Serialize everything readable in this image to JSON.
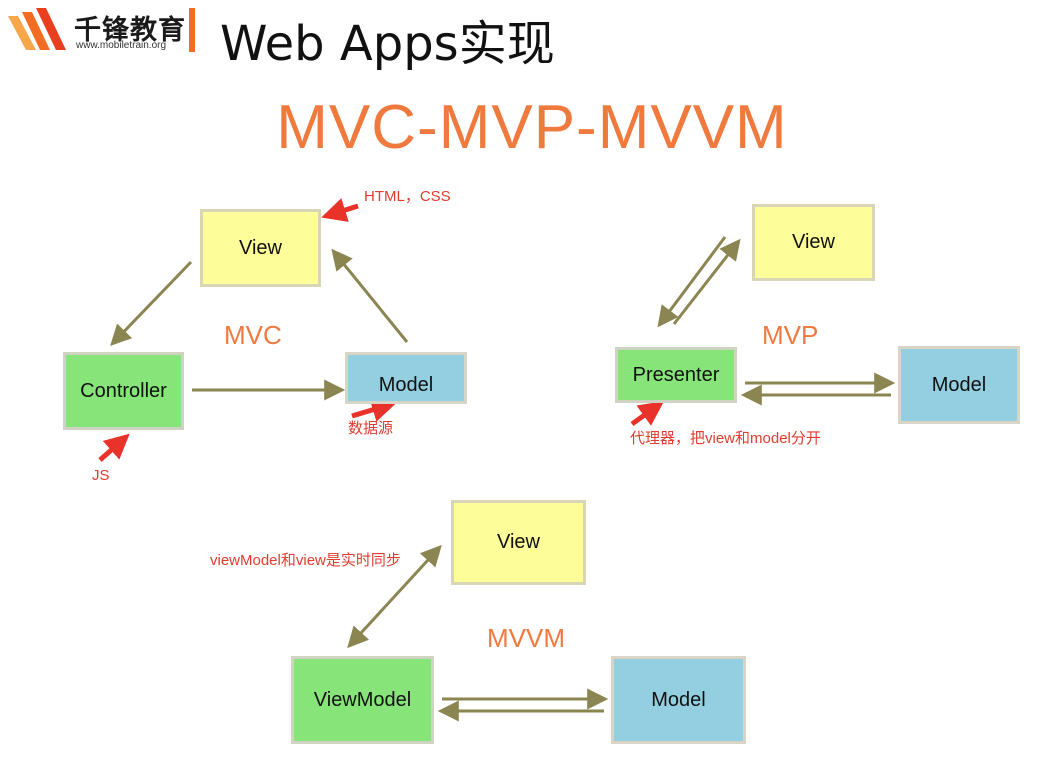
{
  "header": {
    "brand_name": "千锋教育",
    "brand_url": "www.mobiletrain.org",
    "page_title": "Web Apps实现"
  },
  "main_title": "MVC-MVP-MVVM",
  "mvc": {
    "label": "MVC",
    "view": "View",
    "controller": "Controller",
    "model": "Model",
    "note_view": "HTML，CSS",
    "note_model": "数据源",
    "note_controller": "JS"
  },
  "mvp": {
    "label": "MVP",
    "view": "View",
    "presenter": "Presenter",
    "model": "Model",
    "note_presenter": "代理器，把view和model分开"
  },
  "mvvm": {
    "label": "MVVM",
    "view": "View",
    "viewmodel": "ViewModel",
    "model": "Model",
    "note_sync": "viewModel和view是实时同步"
  },
  "colors": {
    "accent_orange": "#f07a3e",
    "note_red": "#e03c2f",
    "arrow_olive": "#8b8552",
    "view_yellow": "#fdfd9a",
    "controller_green": "#86e478",
    "model_blue": "#93cfe0"
  }
}
